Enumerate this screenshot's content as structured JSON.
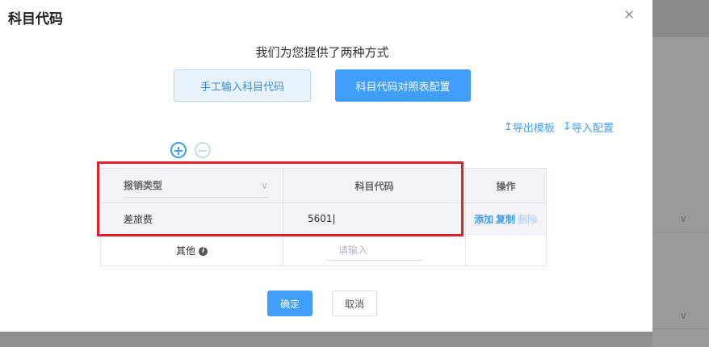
{
  "dialog": {
    "title": "科目代码",
    "close_icon": "close-icon"
  },
  "subtitle": "我们为您提供了两种方式",
  "mode_buttons": {
    "manual": "手工输入科目代码",
    "table": "科目代码对照表配置"
  },
  "links": {
    "export": "导出模板",
    "import": "导入配置"
  },
  "table": {
    "headers": {
      "type": "报销类型",
      "code": "科目代码",
      "ops": "操作"
    },
    "rows": [
      {
        "type": "差旅费",
        "code": "5601",
        "ops": [
          "添加",
          "复制",
          "删除"
        ]
      },
      {
        "type": "其他",
        "code_placeholder": "请输入"
      }
    ]
  },
  "footer": {
    "ok": "确定",
    "cancel": "取消"
  },
  "colors": {
    "accent": "#409eff",
    "highlight": "#e0202a"
  }
}
